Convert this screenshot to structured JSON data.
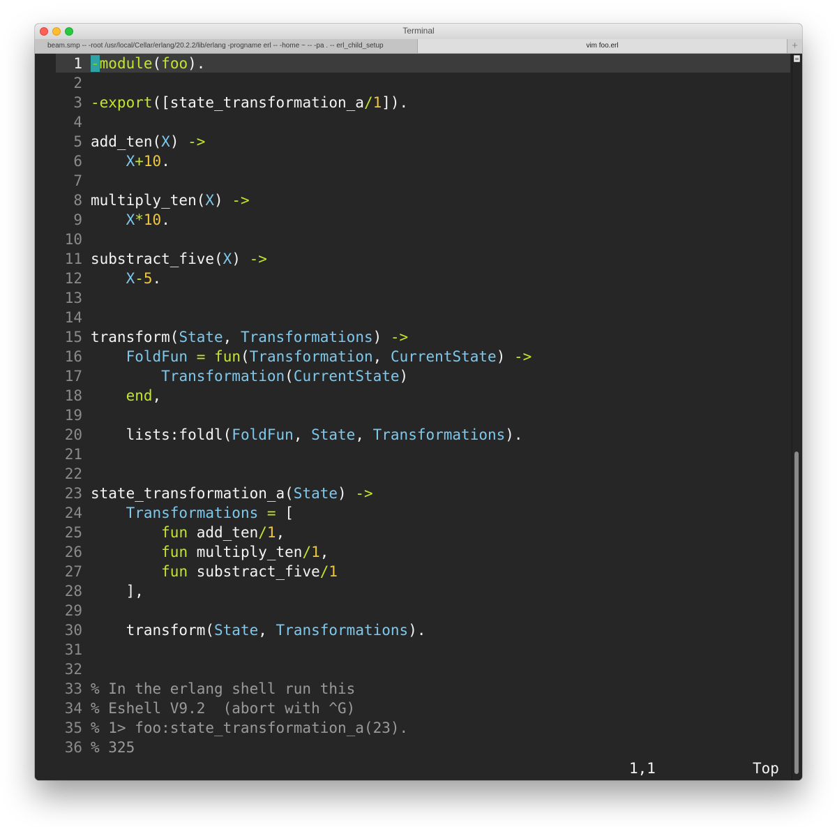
{
  "window": {
    "title": "Terminal"
  },
  "tabs": [
    {
      "label": "beam.smp -- -root /usr/local/Cellar/erlang/20.2.2/lib/erlang -progname erl -- -home ~ -- -pa . -- erl_child_setup"
    },
    {
      "label": "vim foo.erl"
    }
  ],
  "tab_add": {
    "label": "+"
  },
  "editor": {
    "lines": [
      {
        "num": "1",
        "cursor_char": "-",
        "text": "module(foo)."
      },
      {
        "num": "2",
        "text": ""
      },
      {
        "num": "3",
        "text": "-export([state_transformation_a/1])."
      },
      {
        "num": "4",
        "text": ""
      },
      {
        "num": "5",
        "text": "add_ten(X) ->"
      },
      {
        "num": "6",
        "text": "    X+10."
      },
      {
        "num": "7",
        "text": ""
      },
      {
        "num": "8",
        "text": "multiply_ten(X) ->"
      },
      {
        "num": "9",
        "text": "    X*10."
      },
      {
        "num": "10",
        "text": ""
      },
      {
        "num": "11",
        "text": "substract_five(X) ->"
      },
      {
        "num": "12",
        "text": "    X-5."
      },
      {
        "num": "13",
        "text": ""
      },
      {
        "num": "14",
        "text": ""
      },
      {
        "num": "15",
        "text": "transform(State, Transformations) ->"
      },
      {
        "num": "16",
        "text": "    FoldFun = fun(Transformation, CurrentState) ->"
      },
      {
        "num": "17",
        "text": "        Transformation(CurrentState)"
      },
      {
        "num": "18",
        "text": "    end,"
      },
      {
        "num": "19",
        "text": ""
      },
      {
        "num": "20",
        "text": "    lists:foldl(FoldFun, State, Transformations)."
      },
      {
        "num": "21",
        "text": ""
      },
      {
        "num": "22",
        "text": ""
      },
      {
        "num": "23",
        "text": "state_transformation_a(State) ->"
      },
      {
        "num": "24",
        "text": "    Transformations = ["
      },
      {
        "num": "25",
        "text": "        fun add_ten/1,"
      },
      {
        "num": "26",
        "text": "        fun multiply_ten/1,"
      },
      {
        "num": "27",
        "text": "        fun substract_five/1"
      },
      {
        "num": "28",
        "text": "    ],"
      },
      {
        "num": "29",
        "text": ""
      },
      {
        "num": "30",
        "text": "    transform(State, Transformations)."
      },
      {
        "num": "31",
        "text": ""
      },
      {
        "num": "32",
        "text": ""
      },
      {
        "num": "33",
        "text": "% In the erlang shell run this"
      },
      {
        "num": "34",
        "text": "% Eshell V9.2  (abort with ^G)"
      },
      {
        "num": "35",
        "text": "% 1> foo:state_transformation_a(23)."
      },
      {
        "num": "36",
        "text": "% 325"
      }
    ]
  },
  "status": {
    "position": "1,1",
    "scroll": "Top"
  },
  "colors": {
    "background": "#262626",
    "keyword": "#c1e62c",
    "variable": "#7dc8ed",
    "number": "#f0c63c",
    "comment": "#9a9a9a",
    "cursor": "#2fa2a6"
  }
}
